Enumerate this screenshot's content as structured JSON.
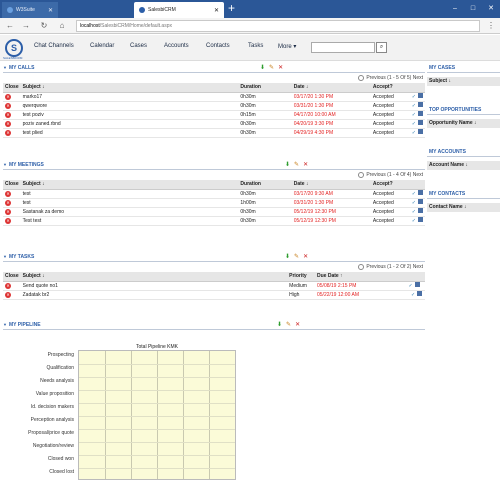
{
  "browser": {
    "tabs": [
      {
        "label": "W3Suite"
      },
      {
        "label": "SalesbiCRM"
      }
    ],
    "new_tab": "+",
    "url_host": "localhost",
    "url_path": "/SalesbiCRM/Home/default.aspx",
    "nav": {
      "back": "←",
      "forward": "→",
      "reload": "↻",
      "home": "⌂"
    },
    "window": {
      "minimize": "–",
      "maximize": "□",
      "close": "✕"
    },
    "menu": "⋮"
  },
  "app": {
    "logo_letter": "S",
    "logo_caption": "SALESBICRM",
    "nav_items": [
      "Chat Channels",
      "Calendar",
      "Cases",
      "Accounts",
      "Contacts",
      "Tasks",
      "More ▾"
    ],
    "search_button": "⌕"
  },
  "calls": {
    "title": "MY CALLS",
    "pager": "Previous (1 - 5 Of 5) Next",
    "columns": [
      "Close",
      "Subject ↓",
      "Duration",
      "Date ↓",
      "Accept?"
    ],
    "rows": [
      {
        "subject": "marko17",
        "duration": "0h30m",
        "date": "03/17/20 1:30 PM",
        "accept": "Accepted"
      },
      {
        "subject": "qwerqwore",
        "duration": "0h30m",
        "date": "03/31/20 1:30 PM",
        "accept": "Accepted"
      },
      {
        "subject": "test poziv",
        "duration": "0h15m",
        "date": "04/17/20 10:00 AM",
        "accept": "Accepted"
      },
      {
        "subject": "poziv zaned.rbnd",
        "duration": "0h30m",
        "date": "04/20/19 3:30 PM",
        "accept": "Accepted"
      },
      {
        "subject": "test plied",
        "duration": "0h30m",
        "date": "04/29/19 4:30 PM",
        "accept": "Accepted"
      }
    ]
  },
  "meetings": {
    "title": "MY MEETINGS",
    "pager": "Previous (1 - 4 Of 4) Next",
    "columns": [
      "Close",
      "Subject ↓",
      "Duration",
      "Date ↓",
      "Accept?"
    ],
    "rows": [
      {
        "subject": "test",
        "duration": "0h30m",
        "date": "03/17/20 9:30 AM",
        "accept": "Accepted"
      },
      {
        "subject": "test",
        "duration": "1h00m",
        "date": "03/31/20 1:30 PM",
        "accept": "Accepted"
      },
      {
        "subject": "Sastanak za demo",
        "duration": "0h30m",
        "date": "05/12/19 12:30 PM",
        "accept": "Accepted"
      },
      {
        "subject": "Test test",
        "duration": "0h30m",
        "date": "05/12/19 12:30 PM",
        "accept": "Accepted"
      }
    ]
  },
  "tasks": {
    "title": "MY TASKS",
    "pager": "Previous (1 - 2 Of 2) Next",
    "columns": [
      "Close",
      "Subject ↓",
      "Priority",
      "Due Date ↑"
    ],
    "rows": [
      {
        "subject": "Send quote no1",
        "priority": "Medium",
        "date": "05/08/19 2:15 PM"
      },
      {
        "subject": "Zadatak br2",
        "priority": "High",
        "date": "05/22/19 12:00 AM"
      }
    ]
  },
  "pipeline": {
    "title": "MY PIPELINE",
    "plot_title": "Total Pipeline KMK",
    "stages": [
      "Prospecting",
      "Qualification",
      "Needs analysis",
      "Value proposition",
      "Id. decision makers",
      "Perception analysis",
      "Proposal/price quote",
      "Negotiation/review",
      "Closed won",
      "Closed lost"
    ]
  },
  "right": {
    "cases": {
      "title": "MY CASES",
      "header": "Subject ↓"
    },
    "opps": {
      "title": "TOP OPPORTUNITIES",
      "header": "Opportunity Name ↓"
    },
    "accounts": {
      "title": "MY ACCOUNTS",
      "header": "Account Name ↓"
    },
    "contacts": {
      "title": "MY CONTACTS",
      "header": "Contact Name ↓"
    }
  },
  "colors": {
    "accent": "#2c5ea8",
    "overdue": "#e32222",
    "tabbar": "#2b5797",
    "plot_bg": "#fbfbd8"
  }
}
